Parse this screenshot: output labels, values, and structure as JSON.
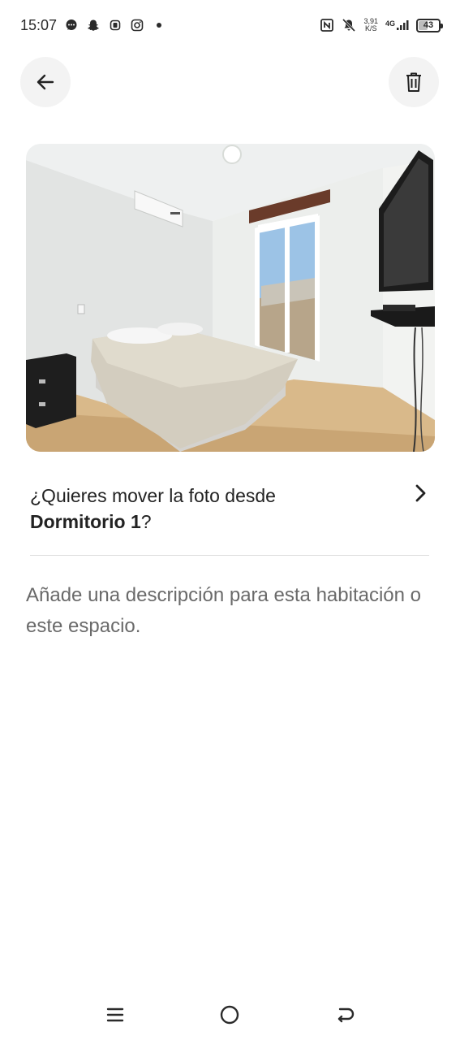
{
  "status_bar": {
    "time": "15:07",
    "net_speed_value": "3,91",
    "net_speed_unit": "K/S",
    "net_type": "4G",
    "battery": "43",
    "icons": [
      "chat-icon",
      "snapchat-icon",
      "app-icon",
      "instagram-icon",
      "dot-icon",
      "nfc-icon",
      "mute-icon",
      "signal-icon",
      "battery-icon"
    ]
  },
  "toolbar": {
    "back_icon": "arrow-left-icon",
    "delete_icon": "trash-icon"
  },
  "move_prompt": {
    "prefix": "¿Quieres mover la foto desde",
    "room": "Dormitorio 1",
    "suffix": "?"
  },
  "description_placeholder": "Añade una descripción para esta habitación o este espacio.",
  "nav_bar": {
    "icons": [
      "menu-icon",
      "home-icon",
      "back-icon"
    ]
  },
  "colors": {
    "text_primary": "#222222",
    "text_secondary": "#6a6a6a",
    "button_bg": "#f3f3f3",
    "divider": "#dddddd"
  }
}
